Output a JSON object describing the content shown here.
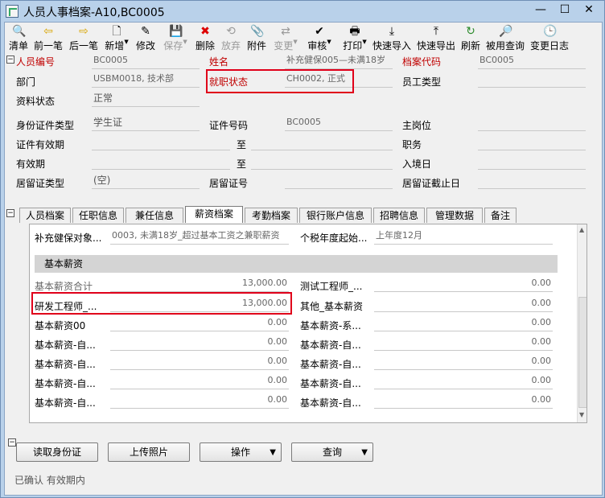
{
  "window": {
    "title": "人员人事档案-A10,BC0005"
  },
  "toolbar": {
    "items": [
      {
        "label": "清单",
        "icon": "🔍"
      },
      {
        "label": "前一笔",
        "icon": "⇦"
      },
      {
        "label": "后一笔",
        "icon": "⇨"
      },
      {
        "label": "新增",
        "icon": "🗋"
      },
      {
        "label": "修改",
        "icon": "✎"
      },
      {
        "label": "保存",
        "icon": "💾"
      },
      {
        "label": "删除",
        "icon": "✖"
      },
      {
        "label": "放弃",
        "icon": "⟲"
      },
      {
        "label": "附件",
        "icon": "📎"
      },
      {
        "label": "变更",
        "icon": "⇄"
      },
      {
        "label": "审核",
        "icon": "✔"
      },
      {
        "label": "打印",
        "icon": "🖶"
      },
      {
        "label": "快速导入",
        "icon": "⤓"
      },
      {
        "label": "快速导出",
        "icon": "⤒"
      },
      {
        "label": "刷新",
        "icon": "↻"
      },
      {
        "label": "被用查询",
        "icon": "🔎"
      },
      {
        "label": "变更日志",
        "icon": "🕒"
      }
    ]
  },
  "header": {
    "staff_no_label": "人员编号",
    "staff_no_value": "BC0005",
    "name_label": "姓名",
    "name_value": "补充健保005—未满18岁",
    "archive_code_label": "档案代码",
    "archive_code_value": "BC0005",
    "dept_label": "部门",
    "dept_value": "USBM0018, 技术部",
    "employ_status_label": "就职状态",
    "employ_status_value": "CH0002, 正式",
    "emp_type_label": "员工类型",
    "emp_type_value": "",
    "data_status_label": "资料状态",
    "data_status_value": "正常",
    "id_type_label": "身份证件类型",
    "id_type_value": "学生证",
    "id_no_label": "证件号码",
    "id_no_value": "BC0005",
    "main_post_label": "主岗位",
    "main_post_value": "",
    "id_valid_label": "证件有效期",
    "to_label_1": "至",
    "duty_label": "职务",
    "valid_label": "有效期",
    "to_label_2": "至",
    "entry_date_label": "入境日",
    "residence_type_label": "居留证类型",
    "residence_type_value": "(空)",
    "residence_no_label": "居留证号",
    "residence_end_label": "居留证截止日"
  },
  "tabs": [
    {
      "label": "人员档案",
      "active": false
    },
    {
      "label": "任职信息",
      "active": false
    },
    {
      "label": "兼任信息",
      "active": false
    },
    {
      "label": "薪资档案",
      "active": true
    },
    {
      "label": "考勤档案",
      "active": false
    },
    {
      "label": "银行账户信息",
      "active": false
    },
    {
      "label": "招聘信息",
      "active": false
    },
    {
      "label": "管理数据",
      "active": false
    },
    {
      "label": "备注",
      "active": false
    }
  ],
  "salary": {
    "insurance_obj_label": "补充健保对象...",
    "insurance_obj_value": "0003, 未满18岁_超过基本工资之兼职薪资",
    "tax_year_label": "个税年度起始...",
    "tax_year_value": "上年度12月",
    "section_title": "基本薪资",
    "rows_left": [
      {
        "label": "基本薪资合计",
        "value": "13,000.00"
      },
      {
        "label": "研发工程师_...",
        "value": "13,000.00"
      },
      {
        "label": "基本薪资00",
        "value": "0.00"
      },
      {
        "label": "基本薪资-自...",
        "value": "0.00"
      },
      {
        "label": "基本薪资-自...",
        "value": "0.00"
      },
      {
        "label": "基本薪资-自...",
        "value": "0.00"
      },
      {
        "label": "基本薪资-自...",
        "value": "0.00"
      }
    ],
    "rows_right": [
      {
        "label": "测试工程师_...",
        "value": "0.00"
      },
      {
        "label": "其他_基本薪资",
        "value": "0.00"
      },
      {
        "label": "基本薪资-系...",
        "value": "0.00"
      },
      {
        "label": "基本薪资-自...",
        "value": "0.00"
      },
      {
        "label": "基本薪资-自...",
        "value": "0.00"
      },
      {
        "label": "基本薪资-自...",
        "value": "0.00"
      },
      {
        "label": "基本薪资-自...",
        "value": "0.00"
      }
    ]
  },
  "buttons": {
    "read_id": "读取身份证",
    "upload_photo": "上传照片",
    "operation": "操作",
    "query": "查询"
  },
  "status_text": "已确认 有效期内",
  "colors": {
    "highlight": "#e0001a",
    "required_label": "#c00000"
  }
}
